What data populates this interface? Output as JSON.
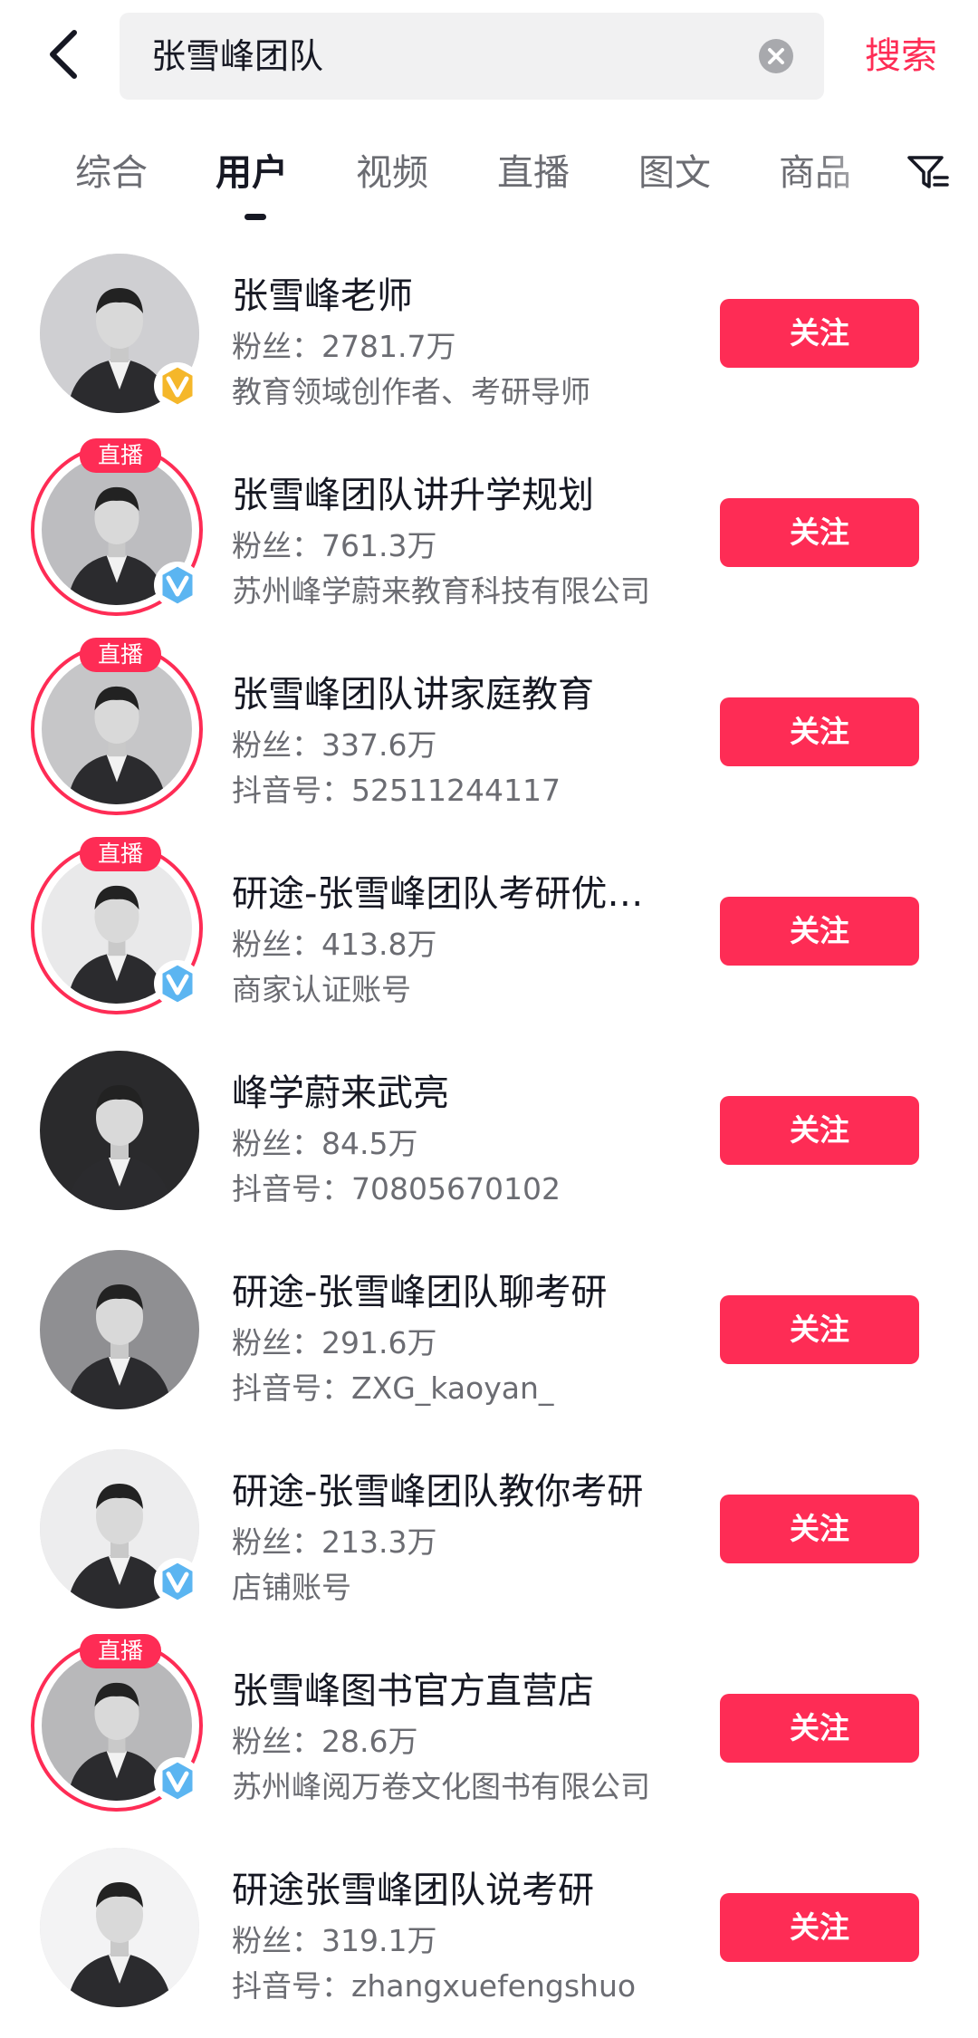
{
  "header": {
    "query": "张雪峰团队",
    "search_label": "搜索"
  },
  "tabs": [
    "综合",
    "用户",
    "视频",
    "直播",
    "图文",
    "商品"
  ],
  "users": [
    {
      "name": "张雪峰老师",
      "fans": "粉丝：2781.7万",
      "sub": "教育领域创作者、考研导师",
      "live": "",
      "badge": "gold",
      "follow": "关注"
    },
    {
      "name": "张雪峰团队讲升学规划",
      "fans": "粉丝：761.3万",
      "sub": "苏州峰学蔚来教育科技有限公司",
      "live": "直播",
      "badge": "blue",
      "follow": "关注"
    },
    {
      "name": "张雪峰团队讲家庭教育",
      "fans": "粉丝：337.6万",
      "sub": "抖音号：52511244117",
      "live": "直播",
      "badge": "",
      "follow": "关注"
    },
    {
      "name": "研途-张雪峰团队考研优…",
      "fans": "粉丝：413.8万",
      "sub": "商家认证账号",
      "live": "直播",
      "badge": "blue",
      "follow": "关注"
    },
    {
      "name": "峰学蔚来武亮",
      "fans": "粉丝：84.5万",
      "sub": "抖音号：70805670102",
      "live": "",
      "badge": "",
      "follow": "关注"
    },
    {
      "name": "研途-张雪峰团队聊考研",
      "fans": "粉丝：291.6万",
      "sub": "抖音号：ZXG_kaoyan_",
      "live": "",
      "badge": "",
      "follow": "关注"
    },
    {
      "name": "研途-张雪峰团队教你考研",
      "fans": "粉丝：213.3万",
      "sub": "店铺账号",
      "live": "",
      "badge": "blue",
      "follow": "关注"
    },
    {
      "name": "张雪峰图书官方直营店",
      "fans": "粉丝：28.6万",
      "sub": "苏州峰阅万卷文化图书有限公司",
      "live": "直播",
      "badge": "blue",
      "follow": "关注"
    },
    {
      "name": "研途张雪峰团队说考研",
      "fans": "粉丝：319.1万",
      "sub": "抖音号：zhangxuefengshuo",
      "live": "",
      "badge": "",
      "follow": "关注"
    }
  ]
}
